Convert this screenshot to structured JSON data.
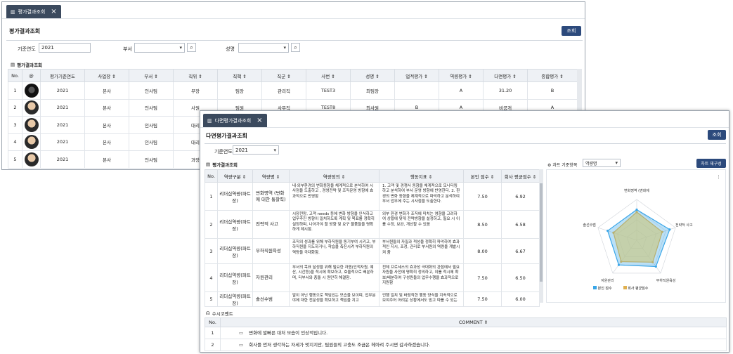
{
  "w1": {
    "tab": "평가결과조회",
    "title": "평가결과조회",
    "search_btn": "조회",
    "filters": {
      "year_label": "기준연도",
      "year_value": "2021",
      "dept_label": "부서",
      "name_label": "성명"
    },
    "section": "평가결과조회",
    "columns": [
      "No.",
      "@",
      "평가기준연도",
      "사업장 ⇕",
      "부서 ⇕",
      "직위 ⇕",
      "직책 ⇕",
      "직군 ⇕",
      "사번 ⇕",
      "성명 ⇕",
      "업적평가 ⇕",
      "역량평가 ⇕",
      "다면평가 ⇕",
      "종합평가 ⇕"
    ],
    "rows": [
      {
        "no": "1",
        "year": "2021",
        "site": "본사",
        "dept": "인사팀",
        "pos": "부장",
        "duty": "팀장",
        "grp": "관리직",
        "id": "TEST3",
        "name": "최팀장",
        "perf": "",
        "comp": "A",
        "multi": "31.20",
        "total": "B"
      },
      {
        "no": "2",
        "year": "2021",
        "site": "본사",
        "dept": "인사팀",
        "pos": "사원",
        "duty": "팀원",
        "grp": "사무직",
        "id": "TEST8",
        "name": "최사원",
        "perf": "B",
        "comp": "A",
        "multi": "비공개",
        "total": "A"
      },
      {
        "no": "3",
        "year": "2021",
        "site": "본사",
        "dept": "인사팀",
        "pos": "대리"
      },
      {
        "no": "4",
        "year": "2021",
        "site": "본사",
        "dept": "인사팀",
        "pos": "대리"
      },
      {
        "no": "5",
        "year": "2021",
        "site": "본사",
        "dept": "인사팀",
        "pos": "과장"
      }
    ]
  },
  "w2": {
    "tab": "다면평가결과조회",
    "title": "다면평가결과조회",
    "search_btn": "조회",
    "year_label": "기준연도",
    "year_value": "2021",
    "section": "평가결과조회",
    "chart_label": "차트 기준항목",
    "chart_select": "역량명",
    "chart_reset": "차트 재구성",
    "columns": [
      "No.",
      "역량구분 ⇕",
      "역량명 ⇕",
      "역량정의 ⇕",
      "행동지표 ⇕",
      "본인 점수 ⇕",
      "회사 평균점수 ⇕"
    ],
    "rows": [
      {
        "no": "1",
        "cat": "리더십역량(파트장)",
        "name": "변화명역 (변화에 대한 통찰력)",
        "def": "내·외부환경의 변화동향을 체계적으로 분석하여 시사점을 도출하고 , 경영전략 및 조직운영 방향에 효과적으로 반영함",
        "ind": "1. 고객 및 경쟁사 동향을 체계적으로 모니터링하고 분석하여 부서 운영 방향에 반영한다. 2. 환경의 변화 동향을 체계적으로 파악하고 분석하여 부서 업무에 주는 시사점을 도출한다.",
        "self": "7.50",
        "avg": "6.92"
      },
      {
        "no": "2",
        "cat": "리더십역량(파트장)",
        "name": "전략적 사고",
        "def": "시장전망, 고객 needs 등에 변화 방향을 인식하고 업무추진 방향이 일치하도록 계획 및 목표를 정확히 설정하며, 나아가야 할 방향 및 요구 물품들을 명확하게 제시함.",
        "ind": "외부 환경 변화가 조직에 미치는 영향을 고려하여 상황에 맞게 전략방향을 설정하고, 필요 시 이를 수정, 보완, 개선할 수 있음",
        "self": "8.50",
        "avg": "6.58"
      },
      {
        "no": "3",
        "cat": "리더십역량(파트장)",
        "name": "부하직원육성",
        "def": "조직의 성과를 위해 부하직원을 동기부여 시키고, 부하직원을 지도하거나, 학습을 촉진시켜 부하직원의 역량을 극대화함.",
        "ind": "부서원들의 자질과 적성을 정확히 파악하여 효과적인 지시, 조정, 관리로 부서원의 역량을 계발시켜 줌",
        "self": "8.00",
        "avg": "6.67"
      },
      {
        "no": "4",
        "cat": "리더십역량(파트장)",
        "name": "자원관리",
        "def": "부서의 목표 달성을 위해 필요한 자원(인적자원, 예산, 시간등)을 적시에 확보하고, 효율적으로 배분하며, 타부서와 충돌 시 원만히 해결함.",
        "ind": "전체 프로세스의 효과성 극대화의 관점에서 필요 자원을 사전에 명확히 정의하고, 이를 적시에 확보/배분하여 구성원들의 업무수행을 효과적으로 지원함",
        "self": "7.50",
        "avg": "6.50"
      },
      {
        "no": "5",
        "cat": "리더십역량(파트장)",
        "name": "솔선수범",
        "def": "말이 아닌 행동으로 책임있는 모습을 보이며, 업무분야에 대한 전문성을 확보하고 책임을 지고",
        "ind": "언행 일치 및 바람직한 행동 양식을 지속적으로 보여주어 어려운 상황에서도 믿고 따를 수 있는",
        "self": "7.50",
        "avg": "6.00"
      }
    ],
    "radar_labels": [
      "변화명역 (변화에",
      "전략적 사고",
      "부하직원육성",
      "자원관리",
      "솔선수범"
    ],
    "legend": [
      "본인 점수",
      "회사 평균점수"
    ],
    "comment_section": "수시코멘트",
    "comment_columns": [
      "No.",
      "COMMENT ⇕"
    ],
    "comments": [
      {
        "no": "1",
        "text": "변화에 발빠른 대처 모습이 인상적입니다."
      },
      {
        "no": "2",
        "text": "회사를 먼저 생각하는 자세가 멋지지만, 팀원들의 고충도 조금은 헤아려 주시면 감사하겠습니다."
      }
    ]
  },
  "chart_data": {
    "type": "radar",
    "categories": [
      "변화명역 (변화에",
      "전략적 사고",
      "부하직원육성",
      "자원관리",
      "솔선수범"
    ],
    "series": [
      {
        "name": "본인 점수",
        "values": [
          7.5,
          8.5,
          8.0,
          7.5,
          7.5
        ]
      },
      {
        "name": "회사 평균점수",
        "values": [
          6.92,
          6.58,
          6.67,
          6.5,
          6.0
        ]
      }
    ],
    "colors": {
      "self": "#3aa6e8",
      "avg": "#c9c98a"
    }
  }
}
